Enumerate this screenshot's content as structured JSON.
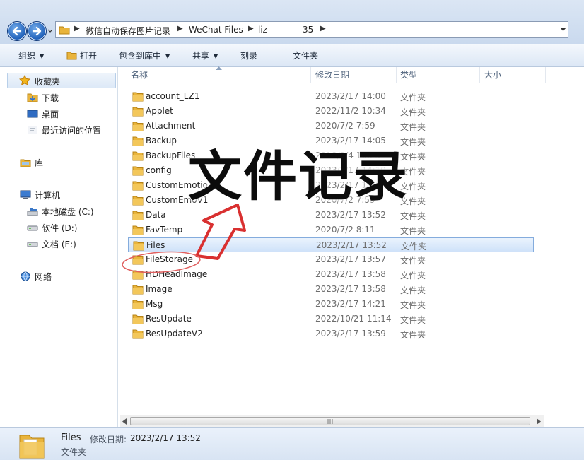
{
  "address": {
    "crumbs": [
      "微信自动保存图片记录",
      "WeChat Files",
      "liz",
      "35"
    ]
  },
  "toolbar": {
    "organize": "组织",
    "open": "打开",
    "include_library": "包含到库中",
    "share": "共享",
    "burn": "刻录",
    "new_folder": "文件夹"
  },
  "nav": {
    "favorites": "收藏夹",
    "downloads": "下载",
    "desktop": "桌面",
    "recent": "最近访问的位置",
    "libraries": "库",
    "computer": "计算机",
    "drive_c": "本地磁盘 (C:)",
    "drive_d": "软件 (D:)",
    "drive_e": "文档 (E:)",
    "network": "网络"
  },
  "columns": {
    "name": "名称",
    "date": "修改日期",
    "type": "类型",
    "size": "大小"
  },
  "files": [
    {
      "name": "account_LZ1",
      "date": "2023/2/17 14:00",
      "type": "文件夹"
    },
    {
      "name": "Applet",
      "date": "2022/11/2 10:34",
      "type": "文件夹"
    },
    {
      "name": "Attachment",
      "date": "2020/7/2 7:59",
      "type": "文件夹"
    },
    {
      "name": "Backup",
      "date": "2023/2/17 14:05",
      "type": "文件夹"
    },
    {
      "name": "BackupFiles",
      "date": "2018/2/4 10:23",
      "type": "文件夹"
    },
    {
      "name": "config",
      "date": "2023/2/17 14:10",
      "type": "文件夹"
    },
    {
      "name": "CustomEmotions",
      "date": "2023/2/17 14:02",
      "type": "文件夹"
    },
    {
      "name": "CustomEmoV1",
      "date": "2020/7/2 7:59",
      "type": "文件夹"
    },
    {
      "name": "Data",
      "date": "2023/2/17 13:52",
      "type": "文件夹"
    },
    {
      "name": "FavTemp",
      "date": "2020/7/2 8:11",
      "type": "文件夹"
    },
    {
      "name": "Files",
      "date": "2023/2/17 13:52",
      "type": "文件夹"
    },
    {
      "name": "FileStorage",
      "date": "2023/2/17 13:57",
      "type": "文件夹"
    },
    {
      "name": "HDHeadImage",
      "date": "2023/2/17 13:58",
      "type": "文件夹"
    },
    {
      "name": "Image",
      "date": "2023/2/17 13:58",
      "type": "文件夹"
    },
    {
      "name": "Msg",
      "date": "2023/2/17 14:21",
      "type": "文件夹"
    },
    {
      "name": "ResUpdate",
      "date": "2022/10/21 11:14",
      "type": "文件夹"
    },
    {
      "name": "ResUpdateV2",
      "date": "2023/2/17 13:59",
      "type": "文件夹"
    }
  ],
  "selected_index": 10,
  "details": {
    "name": "Files",
    "modified_label": "修改日期:",
    "modified_value": "2023/2/17 13:52",
    "type": "文件夹"
  },
  "overlay": {
    "caption": "文件记录"
  },
  "colors": {
    "selection_border": "#84acdd",
    "annotation_red": "#d93030",
    "folder_yellow": "#e9b43c"
  },
  "icons": [
    "back-arrow-icon",
    "forward-arrow-icon",
    "folder-icon",
    "star-icon",
    "desktop-icon",
    "drive-icon",
    "computer-icon",
    "network-icon"
  ]
}
